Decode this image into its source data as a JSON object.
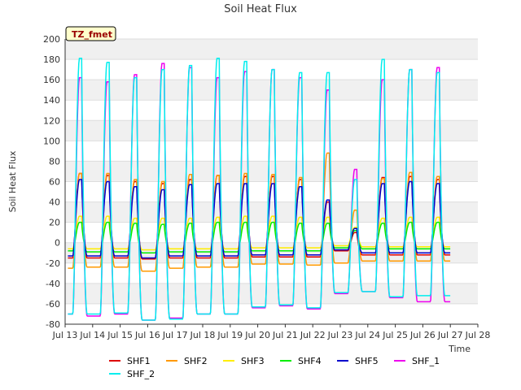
{
  "chart_data": {
    "type": "line",
    "title": "Soil Heat Flux",
    "xlabel": "Time",
    "ylabel": "Soil Heat Flux",
    "ylim": [
      -80,
      200
    ],
    "xlim": [
      13,
      28
    ],
    "yticks": [
      -80,
      -60,
      -40,
      -20,
      0,
      20,
      40,
      60,
      80,
      100,
      120,
      140,
      160,
      180,
      200
    ],
    "xticks": [
      "Jul 13",
      "Jul 14",
      "Jul 15",
      "Jul 16",
      "Jul 17",
      "Jul 18",
      "Jul 19",
      "Jul 20",
      "Jul 21",
      "Jul 22",
      "Jul 23",
      "Jul 24",
      "Jul 25",
      "Jul 26",
      "Jul 27",
      "Jul 28"
    ],
    "grid": true,
    "legend_position": "bottom",
    "badge": "TZ_fmet",
    "series": [
      {
        "name": "SHF1",
        "color": "#dd0000",
        "peaks": [
          68,
          66,
          60,
          58,
          62,
          66,
          65,
          65,
          62,
          40,
          10,
          64,
          65,
          62
        ],
        "troughs": [
          -15,
          -15,
          -15,
          -16,
          -15,
          -15,
          -15,
          -14,
          -14,
          -14,
          -8,
          -12,
          -12,
          -12
        ]
      },
      {
        "name": "SHF2",
        "color": "#ff9900",
        "peaks": [
          68,
          68,
          62,
          60,
          67,
          66,
          68,
          67,
          64,
          88,
          32,
          63,
          69,
          65
        ],
        "troughs": [
          -25,
          -24,
          -24,
          -28,
          -25,
          -24,
          -24,
          -21,
          -21,
          -22,
          -20,
          -18,
          -18,
          -18
        ]
      },
      {
        "name": "SHF3",
        "color": "#ffee00",
        "peaks": [
          26,
          26,
          24,
          24,
          24,
          25,
          26,
          26,
          25,
          25,
          15,
          24,
          25,
          25
        ],
        "troughs": [
          -6,
          -6,
          -6,
          -7,
          -6,
          -6,
          -6,
          -5,
          -5,
          -5,
          -3,
          -4,
          -4,
          -4
        ]
      },
      {
        "name": "SHF4",
        "color": "#00ee00",
        "peaks": [
          20,
          20,
          19,
          18,
          19,
          20,
          20,
          20,
          19,
          19,
          12,
          19,
          20,
          20
        ],
        "troughs": [
          -8,
          -9,
          -9,
          -10,
          -9,
          -9,
          -9,
          -8,
          -8,
          -8,
          -5,
          -6,
          -6,
          -6
        ]
      },
      {
        "name": "SHF5",
        "color": "#0000cc",
        "peaks": [
          62,
          60,
          55,
          52,
          57,
          58,
          58,
          58,
          55,
          42,
          14,
          58,
          60,
          58
        ],
        "troughs": [
          -13,
          -13,
          -13,
          -15,
          -13,
          -13,
          -13,
          -12,
          -12,
          -12,
          -7,
          -10,
          -10,
          -10
        ]
      },
      {
        "name": "SHF_1",
        "color": "#ee00ee",
        "peaks": [
          162,
          158,
          165,
          176,
          172,
          162,
          168,
          170,
          162,
          150,
          72,
          160,
          170,
          172
        ],
        "troughs": [
          -70,
          -72,
          -70,
          -76,
          -74,
          -70,
          -70,
          -64,
          -62,
          -65,
          -50,
          -48,
          -54,
          -58
        ]
      },
      {
        "name": "SHF_2",
        "color": "#00eeee",
        "peaks": [
          181,
          177,
          162,
          170,
          174,
          181,
          178,
          170,
          167,
          167,
          62,
          180,
          170,
          167
        ],
        "troughs": [
          -70,
          -70,
          -69,
          -76,
          -75,
          -70,
          -70,
          -63,
          -61,
          -64,
          -49,
          -48,
          -53,
          -52
        ]
      }
    ]
  }
}
